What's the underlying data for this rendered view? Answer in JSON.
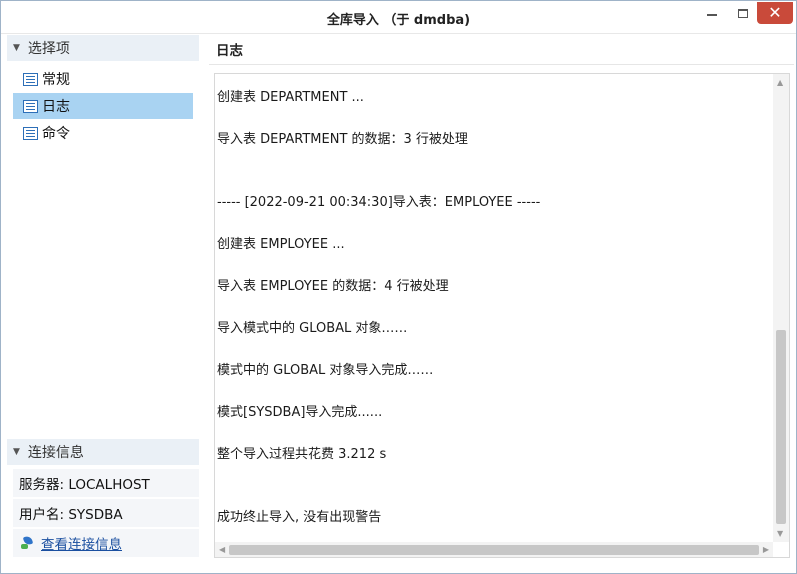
{
  "window": {
    "title": "全库导入 （于 dmdba)",
    "close_glyph": "✕"
  },
  "sidebar": {
    "options_header": "选择项",
    "items": [
      {
        "label": "常规",
        "icon": "document-icon",
        "selected": false
      },
      {
        "label": "日志",
        "icon": "document-icon",
        "selected": true
      },
      {
        "label": "命令",
        "icon": "document-icon",
        "selected": false
      }
    ],
    "connection_header": "连接信息",
    "server": "服务器: LOCALHOST",
    "user": "用户名: SYSDBA",
    "view_connection": "查看连接信息"
  },
  "main": {
    "section_title": "日志",
    "log_lines": [
      "创建表 DEPARTMENT ...",
      "导入表 DEPARTMENT 的数据：3 行被处理",
      "----- [2022-09-21 00:34:30]导入表：EMPLOYEE -----",
      "创建表 EMPLOYEE ...",
      "导入表 EMPLOYEE 的数据：4 行被处理",
      "导入模式中的 GLOBAL 对象……",
      "模式中的 GLOBAL 对象导入完成……",
      "模式[SYSDBA]导入完成......",
      "整个导入过程共花费   3.212 s",
      "成功终止导入, 没有出现警告"
    ]
  },
  "colors": {
    "selected_bg": "#a9d3f2",
    "section_bg": "#eaf0f6",
    "close_button": "#c94a3a",
    "link": "#1a4fa0"
  }
}
